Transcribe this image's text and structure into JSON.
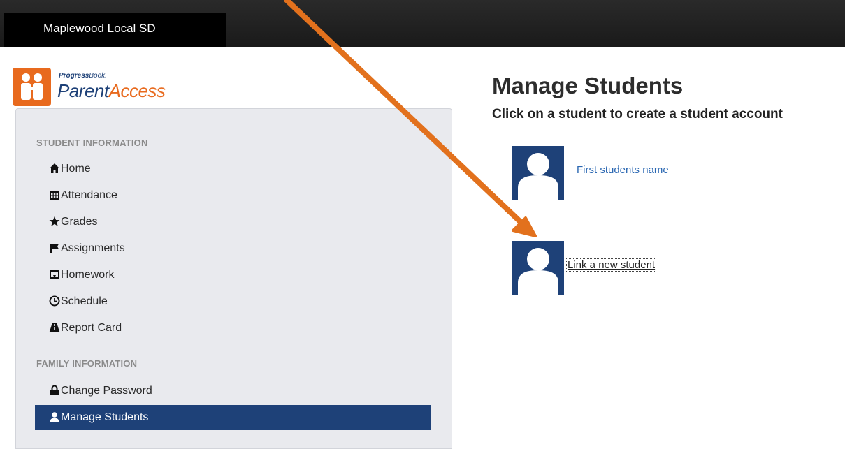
{
  "header": {
    "district_name": "Maplewood Local SD"
  },
  "logo": {
    "brand_small_bold": "Progress",
    "brand_small_light": "Book.",
    "brand_big_left": "Parent",
    "brand_big_right": "Access",
    "icon": "parents-icon"
  },
  "sidebar": {
    "student_section_label": "STUDENT INFORMATION",
    "family_section_label": "FAMILY INFORMATION",
    "student_items": [
      {
        "label": "Home",
        "icon": "home-icon"
      },
      {
        "label": "Attendance",
        "icon": "calendar-icon"
      },
      {
        "label": "Grades",
        "icon": "star-icon"
      },
      {
        "label": "Assignments",
        "icon": "flag-icon"
      },
      {
        "label": "Homework",
        "icon": "inbox-icon"
      },
      {
        "label": "Schedule",
        "icon": "clock-icon"
      },
      {
        "label": "Report Card",
        "icon": "road-icon"
      }
    ],
    "family_items": [
      {
        "label": "Change Password",
        "icon": "lock-icon"
      },
      {
        "label": "Manage Students",
        "icon": "user-icon",
        "active": true
      }
    ]
  },
  "main": {
    "title": "Manage Students",
    "subtitle": "Click on a student to create a student account",
    "students": [
      {
        "name": "First students name"
      }
    ],
    "link_new_student": "Link a new student"
  },
  "colors": {
    "accent_navy": "#1e4178",
    "brand_orange": "#e86a1e",
    "annotation_arrow": "#e2711d"
  }
}
